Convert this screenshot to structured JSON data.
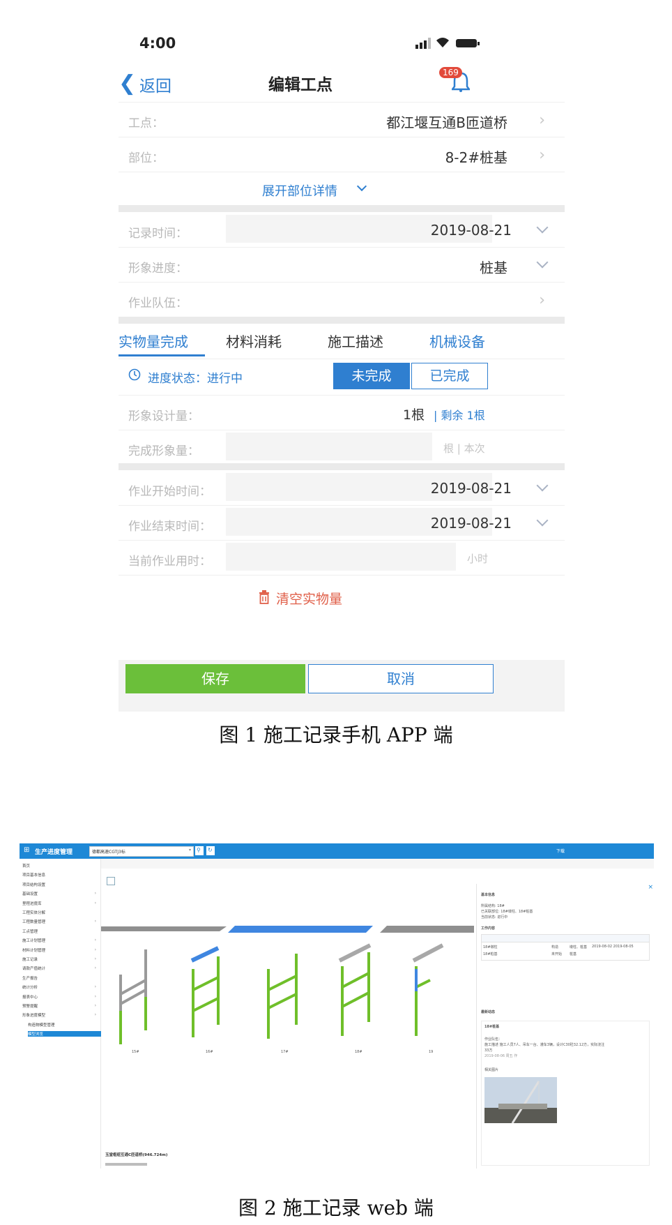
{
  "figure1": {
    "caption": "图 1  施工记录手机 APP 端",
    "status_bar": {
      "time": "4:00"
    },
    "nav": {
      "back_label": "返回",
      "title": "编辑工点",
      "badge": "169"
    },
    "rows": {
      "site_label": "工点：",
      "site_value": "都江堰互通B匝道桥",
      "part_label": "部位：",
      "part_value": "8-2#桩基",
      "expand_label": "展开部位详情",
      "record_time_label": "记录时间：",
      "record_time_value": "2019-08-21",
      "progress_label": "形象进度：",
      "progress_value": "桩基",
      "team_label": "作业队伍："
    },
    "tabs": [
      "实物量完成",
      "材料消耗",
      "施工描述",
      "机械设备"
    ],
    "status": {
      "label": "进度状态：进行中",
      "btn_incomplete": "未完成",
      "btn_complete": "已完成"
    },
    "design": {
      "label": "形象设计量：",
      "value": "1根",
      "remaining": "| 剩余 1根"
    },
    "done": {
      "label": "完成形象量：",
      "unit": "根 | 本次"
    },
    "start": {
      "label": "作业开始时间：",
      "value": "2019-08-21"
    },
    "end": {
      "label": "作业结束时间：",
      "value": "2019-08-21"
    },
    "duration": {
      "label": "当前作业用时：",
      "unit": "小时"
    },
    "clear_label": "清空实物量",
    "save_label": "保存",
    "cancel_label": "取消"
  },
  "figure2": {
    "caption": "图 2  施工记录 web 端",
    "app_title": "生产进度管理",
    "project_select": "德都高速CGTJ3标",
    "top_right": "下载",
    "sidebar": [
      {
        "label": "首页",
        "caret": false
      },
      {
        "label": "项目基本信息",
        "caret": false
      },
      {
        "label": "项目结构设置",
        "caret": false
      },
      {
        "label": "基础设置",
        "caret": true
      },
      {
        "label": "里程进度库",
        "caret": true
      },
      {
        "label": "工程实体分解",
        "caret": false
      },
      {
        "label": "工程数量管理",
        "caret": true
      },
      {
        "label": "工点管理",
        "caret": false
      },
      {
        "label": "施工计划管理",
        "caret": true
      },
      {
        "label": "材料计划管理",
        "caret": true
      },
      {
        "label": "施工记录",
        "caret": true
      },
      {
        "label": "请款产值统计",
        "caret": true
      },
      {
        "label": "生产报告",
        "caret": false
      },
      {
        "label": "统计分析",
        "caret": true
      },
      {
        "label": "报表中心",
        "caret": true
      },
      {
        "label": "预警提醒",
        "caret": true
      },
      {
        "label": "形象进度模型",
        "caret": true
      },
      {
        "label": "构造物模型管理",
        "caret": false
      },
      {
        "label": "模型浏览",
        "caret": false
      }
    ],
    "pier_labels": [
      "15#",
      "16#",
      "17#",
      "18#",
      "19"
    ],
    "bottom_label": "玉堂枢纽互通C匝道桥(946.724m)",
    "panel": {
      "basic_title": "基本信息",
      "basic_lines": [
        "所属结构: 18#",
        "已关联部位: 18#墩柱、18#桩基",
        "当前状态: 进行中"
      ],
      "work_title": "工作内容",
      "work_rows": [
        [
          "18#墩柱",
          "构造",
          "墩柱、桩基",
          "2019-08-02 2019-08-05"
        ],
        [
          "18#桩基",
          "未开始",
          "桩基"
        ]
      ],
      "dynamic_title": "最新动态",
      "dynamic_item": "18#桩基",
      "dynamic_lines": [
        "作业队伍：",
        "施工描述 施工人员7人、吊车一台、灌车3辆，设计C30砼32.12方，实际浇注",
        "33方",
        "2019-08-06 周五 作"
      ],
      "photo_label": "相关图片"
    }
  }
}
